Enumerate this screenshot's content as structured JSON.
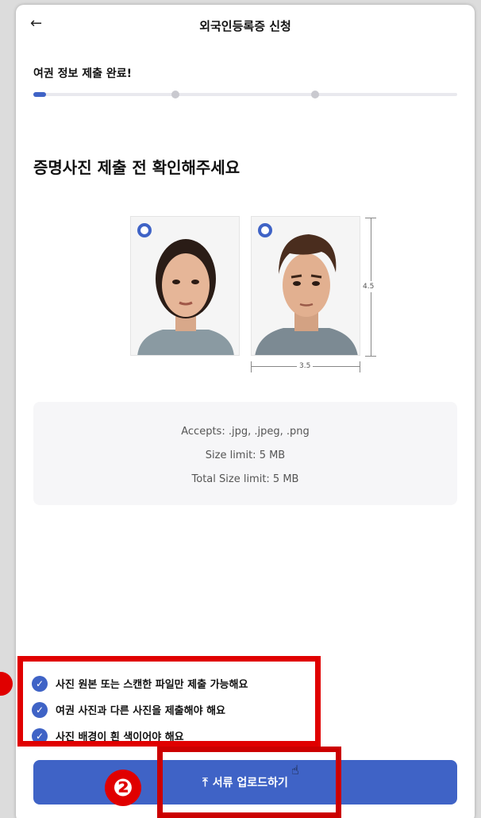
{
  "header": {
    "back_icon": "arrow-left-icon",
    "back_glyph": "←",
    "title": "외국인등록증 신청"
  },
  "progress": {
    "label": "여권 정보 제출 완료!",
    "steps": 3,
    "current_step": 1,
    "fill_fraction": 0.03
  },
  "main": {
    "heading": "증명사진 제출 전 확인해주세요"
  },
  "examples": {
    "dimension_height": "4.5",
    "dimension_width": "3.5"
  },
  "upload_info": {
    "accepts": "Accepts: .jpg, .jpeg, .png",
    "size_limit": "Size limit: 5 MB",
    "total_limit": "Total Size limit: 5 MB"
  },
  "checklist": [
    {
      "text": "사진 원본 또는 스캔한 파일만 제출 가능해요",
      "icon": "check-circle-icon"
    },
    {
      "text": "여권 사진과 다른 사진을 제출해야 해요",
      "icon": "check-circle-icon"
    },
    {
      "text": "사진 배경이 흰 색이어야 해요",
      "icon": "check-circle-icon"
    }
  ],
  "upload_button": {
    "label": "서류 업로드하기",
    "icon": "upload-icon",
    "glyph": "⤒"
  },
  "annotations": {
    "marker_2": "❷"
  },
  "colors": {
    "accent": "#3f63c6",
    "highlight": "#e00000"
  }
}
